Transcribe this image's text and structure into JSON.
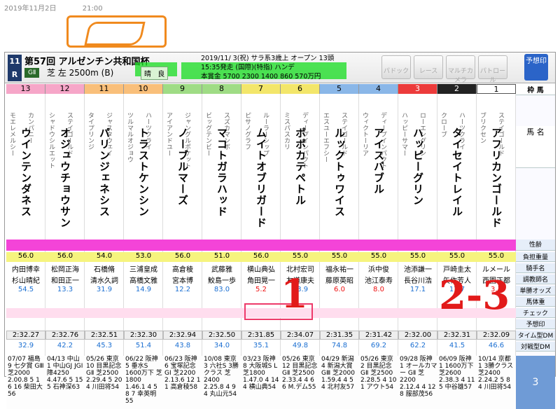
{
  "datebar": {
    "date": "2019年11月2日",
    "time": "21:00"
  },
  "race": {
    "number": "11",
    "round": "R",
    "name": "第57回 アルゼンチン共和国杯",
    "grade": "GⅡ",
    "course": "芝 左 2500m (B)",
    "weather": "晴",
    "going": "良",
    "info_line1": "2019/11/ 3(祝) サラ系3歳上 オープン 13頭",
    "info_line2": "15:35発走 (国際)(特指) ハンデ",
    "info_line3": "本賞金 5700 2300 1400 860 570万円"
  },
  "buttons": [
    "パドック",
    "レース",
    "マルチカメラ",
    "パトロール"
  ],
  "predict_button": "予想印",
  "right_labels": [
    "枠 馬",
    "馬 名",
    "性齢",
    "負担重量",
    "騎手名",
    "調教師名",
    "単勝オッズ",
    "馬体重",
    "チェック",
    "予想印",
    "タイム型DM",
    "対戦型DM"
  ],
  "right_race_num": "3",
  "horses": [
    {
      "waku": "8",
      "num": "13",
      "name": "ウインテンダネス",
      "sire": "カンパニー",
      "dam": "モエレメルシー",
      "weight": "56.0",
      "jockey": "内田博幸",
      "trainer": "杉山晴紀",
      "odds": "54.5",
      "time": "2:32.27",
      "dm": "32.9",
      "past": "07/07 福島 9 七夕賞 GⅢ 芝2000 2.00.8 5 1 6 16 柴田大56",
      "oddsred": false
    },
    {
      "waku": "8",
      "num": "12",
      "name": "オジュウチョウサン",
      "sire": "ステイゴールド",
      "dam": "シャドウシルエット",
      "weight": "56.0",
      "jockey": "松岡正海",
      "trainer": "和田正一",
      "odds": "13.3",
      "time": "2:32.76",
      "dm": "42.2",
      "past": "04/13 中山 1 中山GJ JGⅠ 障4250 4.47.6 5 15 5 石神深63",
      "oddsred": false
    },
    {
      "waku": "7",
      "num": "11",
      "name": "パリンジェネシス",
      "sire": "ジャスタウェイ",
      "dam": "タイプリンジ",
      "weight": "54.0",
      "jockey": "石橋脩",
      "trainer": "清水久詞",
      "odds": "31.9",
      "time": "2:32.51",
      "dm": "45.3",
      "past": "05/26 東京 10 目黒記念 GⅡ 芝2500 2.29.4 5 20 4 川田将54",
      "oddsred": false
    },
    {
      "waku": "7",
      "num": "10",
      "name": "トラストケンシン",
      "sire": "ハーツクライ",
      "dam": "ツルマルオジョウ",
      "weight": "53.0",
      "jockey": "三浦皇成",
      "trainer": "高橋文雅",
      "odds": "14.9",
      "time": "2:32.30",
      "dm": "51.4",
      "past": "06/22 阪神 5 垂水S 1600万下 芝1800 1.46.1 4 5 8 7 幸英明55",
      "oddsred": false
    },
    {
      "waku": "6",
      "num": "9",
      "name": "ノーブルマーズ",
      "sire": "ジャングルポケット",
      "dam": "アイアンドユー",
      "weight": "56.0",
      "jockey": "高倉稜",
      "trainer": "宮本博",
      "odds": "12.2",
      "time": "2:32.94",
      "dm": "43.8",
      "past": "06/23 阪神 6 宝塚記念 GⅠ 芝2200 2.13.6 12 1 1 高倉稜58",
      "oddsred": false
    },
    {
      "waku": "6",
      "num": "8",
      "name": "マコトガラハッド",
      "sire": "スズカマンボ",
      "dam": "ビッグテンビー",
      "weight": "51.0",
      "jockey": "武藤雅",
      "trainer": "鮫島一歩",
      "odds": "83.0",
      "time": "2:32.50",
      "dm": "34.0",
      "past": "10/08 東京 3 六社S 3勝クラス 芝2400 2.25.8 4 9 4 丸山元54",
      "oddsred": false
    },
    {
      "waku": "5",
      "num": "7",
      "name": "ムイトオブリガード",
      "sire": "ルーラーシップ",
      "dam": "ピサノグラフ",
      "weight": "56.0",
      "jockey": "横山典弘",
      "trainer": "角田晃一",
      "odds": "5.2",
      "time": "2:31.85",
      "dm": "35.1",
      "past": "03/23 阪神 8 大阪城S L 芝1800 1.47.0 4 14 4 横山典54",
      "oddsred": true
    },
    {
      "waku": "5",
      "num": "6",
      "name": "ポポカテペトル",
      "sire": "ディープインパクト",
      "dam": "ミスパスカリ",
      "weight": "55.0",
      "jockey": "北村宏司",
      "trainer": "友道康夫",
      "odds": "43.9",
      "time": "2:34.07",
      "dm": "49.8",
      "past": "05/26 東京 12 目黒記念 GⅡ 芝2500 2.33.4 4 6 6 M.デム55",
      "oddsred": false
    },
    {
      "waku": "4",
      "num": "5",
      "name": "ルックトゥワイス",
      "sire": "ステイゴールド",
      "dam": "エスユーエフシー",
      "weight": "55.0",
      "jockey": "福永祐一",
      "trainer": "藤原英昭",
      "odds": "6.0",
      "time": "2:31.35",
      "dm": "74.8",
      "past": "04/29 新潟 4 新潟大賞 GⅢ 芝2000 1.59.4 4 5 4 北村友57",
      "oddsred": true
    },
    {
      "waku": "4",
      "num": "4",
      "name": "アイスバブル",
      "sire": "ディープインパクト",
      "dam": "ウィクトーリア",
      "weight": "55.0",
      "jockey": "浜中俊",
      "trainer": "池江泰寿",
      "odds": "8.0",
      "time": "2:31.42",
      "dm": "69.2",
      "past": "05/26 東京 2 目黒記念 GⅡ 芝2500 2.28.5 4 10 1 アウト54",
      "oddsred": true
    },
    {
      "waku": "3",
      "num": "3",
      "name": "ハッピーグリン",
      "sire": "ローエングリン",
      "dam": "ハッピーサマー",
      "weight": "55.0",
      "jockey": "池添謙一",
      "trainer": "長谷川浩",
      "odds": "17.1",
      "time": "2:32.00",
      "dm": "62.2",
      "past": "09/28 阪神 1 オールカマー GⅡ 芝2200 2.12.4 4 12 8 服部茂56",
      "oddsred": false
    },
    {
      "waku": "2",
      "num": "2",
      "name": "タイセイトレイル",
      "sire": "ハーツクライ",
      "dam": "クローブ",
      "weight": "55.0",
      "jockey": "戸崎圭太",
      "trainer": "矢作芳人",
      "odds": "17.7",
      "time": "2:32.31",
      "dm": "41.5",
      "past": "06/09 阪神 1 1600万下 芝2600 2.38.3 4 11 5 中谷雄57",
      "oddsred": false
    },
    {
      "waku": "1",
      "num": "1",
      "name": "アフリカンゴールド",
      "sire": "ステイゴールド",
      "dam": "ブリクセン",
      "weight": "55.0",
      "jockey": "ルメール",
      "trainer": "西園正都",
      "odds": "3.3",
      "time": "2:32.09",
      "dm": "46.6",
      "past": "10/14 京都 1 3勝クラス 芝2400 2.24.2 5 8 4 川田将54",
      "oddsred": true
    }
  ],
  "annotations": {
    "mark1": "1",
    "mark23": "2-3"
  },
  "colors": {
    "waku8": "#f6a6c8",
    "waku7": "#f9bf7a",
    "waku6": "#9fdc85",
    "waku5": "#f3e66a",
    "waku4": "#8ab7e8",
    "waku3": "#ec3b3b",
    "waku2": "#222222",
    "waku1": "#ffffff",
    "accent": "#2b64c8"
  }
}
